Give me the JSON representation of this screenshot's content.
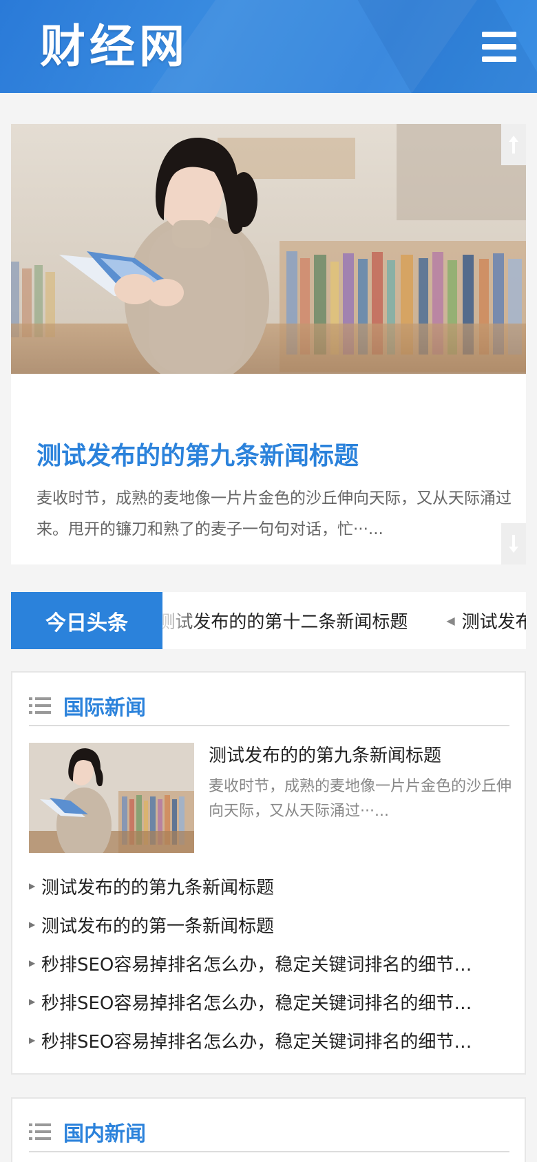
{
  "header": {
    "logo_text": "财经网",
    "menu_icon": "hamburger-menu-icon"
  },
  "slider": {
    "title": "测试发布的的第九条新闻标题",
    "description": "麦收时节，成熟的麦地像一片片金色的沙丘伸向天际，又从天际涌过来。甩开的镰刀和熟了的麦子一句句对话，忙···...",
    "prev_icon": "arrow-up-icon",
    "next_icon": "arrow-down-icon"
  },
  "headline": {
    "label": "今日头条",
    "items": [
      "测试发布的的第十二条新闻标题",
      "测试发布的的第十一条新闻标题"
    ]
  },
  "international": {
    "title": "国际新闻",
    "feature": {
      "title": "测试发布的的第九条新闻标题",
      "description": "麦收时节，成熟的麦地像一片片金色的沙丘伸向天际，又从天际涌过···..."
    },
    "items": [
      "测试发布的的第九条新闻标题",
      "测试发布的的第一条新闻标题",
      "秒排SEO容易掉排名怎么办，稳定关键词排名的细节…",
      "秒排SEO容易掉排名怎么办，稳定关键词排名的细节…",
      "秒排SEO容易掉排名怎么办，稳定关键词排名的细节…"
    ]
  },
  "domestic": {
    "title": "国内新闻"
  },
  "colors": {
    "brand_blue": "#2b82db",
    "page_bg": "#f4f4f4"
  }
}
